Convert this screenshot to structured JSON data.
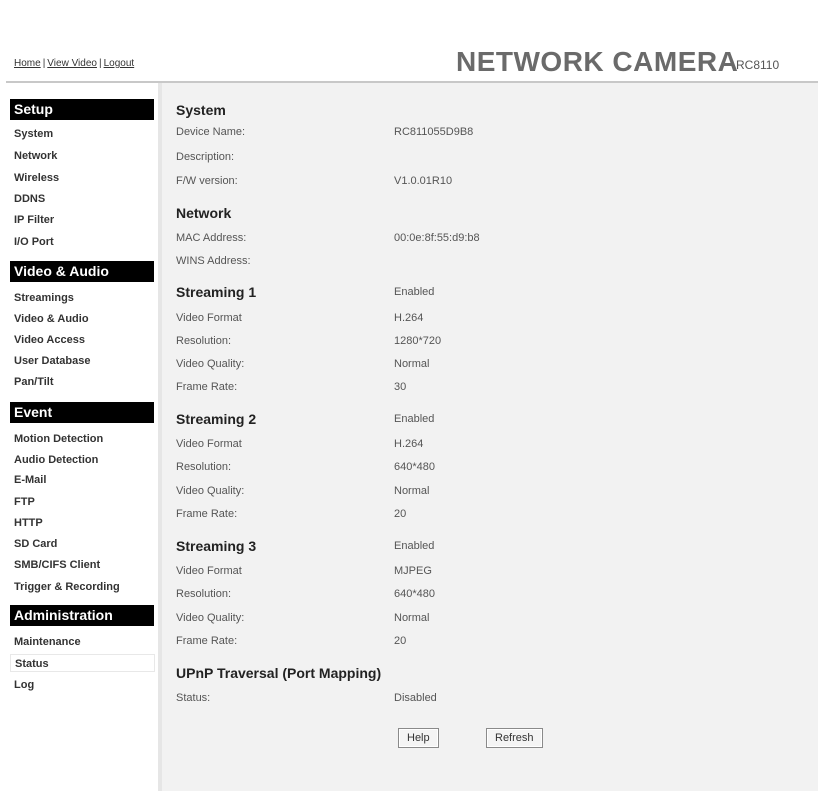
{
  "header": {
    "nav": [
      "Home",
      "View Video",
      "Logout"
    ],
    "separator": "|",
    "brand": "NETWORK CAMERA",
    "model": "RC8110"
  },
  "sidebar": {
    "sections": [
      {
        "title": "Setup",
        "items": [
          "System",
          "Network",
          "Wireless",
          "DDNS",
          "IP Filter",
          "I/O Port"
        ]
      },
      {
        "title": "Video & Audio",
        "items": [
          "Streamings",
          "Video & Audio",
          "Video Access",
          "User Database",
          "Pan/Tilt"
        ]
      },
      {
        "title": "Event",
        "items": [
          "Motion Detection",
          "Audio Detection",
          "E-Mail",
          "FTP",
          "HTTP",
          "SD Card",
          "SMB/CIFS Client",
          "Trigger & Recording"
        ]
      },
      {
        "title": "Administration",
        "items": [
          "Maintenance",
          "Status",
          "Log"
        ]
      }
    ],
    "active_item": "Status"
  },
  "main": {
    "system": {
      "title": "System",
      "device_name_label": "Device Name:",
      "device_name": "RC811055D9B8",
      "description_label": "Description:",
      "description": "",
      "fw_label": "F/W version:",
      "fw": "V1.0.01R10"
    },
    "network": {
      "title": "Network",
      "mac_label": "MAC Address:",
      "mac": "00:0e:8f:55:d9:b8",
      "wins_label": "WINS Address:",
      "wins": ""
    },
    "streams": [
      {
        "title": "Streaming 1",
        "state": "Enabled",
        "format_label": "Video Format",
        "format": "H.264",
        "resolution_label": "Resolution:",
        "resolution": "1280*720",
        "quality_label": "Video Quality:",
        "quality": "Normal",
        "framerate_label": "Frame Rate:",
        "framerate": "30"
      },
      {
        "title": "Streaming 2",
        "state": "Enabled",
        "format_label": "Video Format",
        "format": "H.264",
        "resolution_label": "Resolution:",
        "resolution": "640*480",
        "quality_label": "Video Quality:",
        "quality": "Normal",
        "framerate_label": "Frame Rate:",
        "framerate": "20"
      },
      {
        "title": "Streaming 3",
        "state": "Enabled",
        "format_label": "Video Format",
        "format": "MJPEG",
        "resolution_label": "Resolution:",
        "resolution": "640*480",
        "quality_label": "Video Quality:",
        "quality": "Normal",
        "framerate_label": "Frame Rate:",
        "framerate": "20"
      }
    ],
    "upnp": {
      "title": "UPnP Traversal (Port Mapping)",
      "status_label": "Status:",
      "status": "Disabled"
    },
    "buttons": {
      "help": "Help",
      "refresh": "Refresh"
    }
  }
}
